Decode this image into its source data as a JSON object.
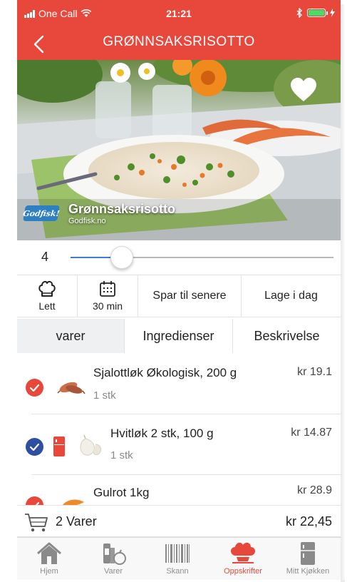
{
  "status_bar": {
    "carrier": "One Call",
    "time": "21:21"
  },
  "nav": {
    "title": "GRØNNSAKSRISOTTO"
  },
  "hero": {
    "recipe_name": "Grønnsaksrisotto",
    "source": "Godfisk.no",
    "logo_text": "Godfisk!"
  },
  "servings_slider": {
    "value": "4",
    "fraction": 0.195
  },
  "info": {
    "difficulty": "Lett",
    "time": "30 min",
    "save_later": "Spar til senere",
    "make_today": "Lage i dag"
  },
  "tabs": [
    {
      "label": "varer",
      "active": true
    },
    {
      "label": "Ingredienser",
      "active": false
    },
    {
      "label": "Beskrivelse",
      "active": false
    }
  ],
  "items": [
    {
      "name": "Sjalottløk Økologisk, 200 g",
      "qty": "1 stk",
      "price": "kr 19.1",
      "check_color": "#e8483c",
      "has_fridge": false,
      "icon": "shallot-icon"
    },
    {
      "name": "Hvitløk 2 stk, 100 g",
      "qty": "1 stk",
      "price": "kr 14.87",
      "check_color": "#2f4fa3",
      "has_fridge": true,
      "icon": "garlic-icon"
    },
    {
      "name": "Gulrot  1kg",
      "qty": "",
      "price": "kr 28.9",
      "check_color": "#e8483c",
      "has_fridge": false,
      "icon": "carrot-icon"
    }
  ],
  "cart": {
    "count": "2 Varer",
    "total": "kr 22,45"
  },
  "tabbar": [
    {
      "label": "Hjem",
      "icon": "home-icon",
      "active": false
    },
    {
      "label": "Varer",
      "icon": "groceries-icon",
      "active": false
    },
    {
      "label": "Skann",
      "icon": "barcode-icon",
      "active": false
    },
    {
      "label": "Oppskrifter",
      "icon": "chef-hat-icon",
      "active": true
    },
    {
      "label": "Mitt Kjøkken",
      "icon": "fridge-icon",
      "active": false
    }
  ],
  "colors": {
    "brand": "#e8483c",
    "accent_blue": "#3b7ed6",
    "check_blue": "#2f4fa3"
  }
}
